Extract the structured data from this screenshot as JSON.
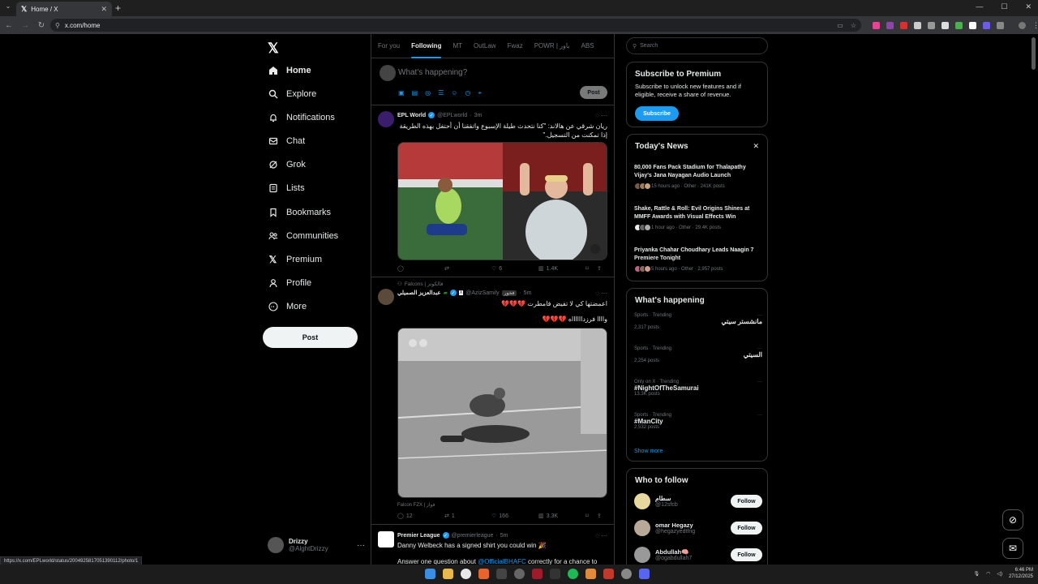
{
  "browser": {
    "tab_title": "Home / X",
    "url": "x.com/home",
    "status_url": "https://x.com/EPLworld/status/2004925817051390112/photo/1"
  },
  "sidebar": {
    "logo": "𝕏",
    "items": [
      {
        "label": "Home",
        "icon": "home-icon"
      },
      {
        "label": "Explore",
        "icon": "search-icon"
      },
      {
        "label": "Notifications",
        "icon": "bell-icon"
      },
      {
        "label": "Chat",
        "icon": "mail-icon"
      },
      {
        "label": "Grok",
        "icon": "grok-icon"
      },
      {
        "label": "Lists",
        "icon": "list-icon"
      },
      {
        "label": "Bookmarks",
        "icon": "bookmark-icon"
      },
      {
        "label": "Communities",
        "icon": "people-icon"
      },
      {
        "label": "Premium",
        "icon": "x-icon"
      },
      {
        "label": "Profile",
        "icon": "person-icon"
      },
      {
        "label": "More",
        "icon": "more-icon"
      }
    ],
    "post_label": "Post",
    "account": {
      "name": "Drizzy",
      "handle": "@AlghtDrizzy"
    }
  },
  "feed": {
    "tabs": [
      "For you",
      "Following",
      "MT",
      "OutLaw",
      "Fwaz",
      "POWR | باور",
      "ABS"
    ],
    "compose_placeholder": "What's happening?",
    "compose_post": "Post",
    "tweets": [
      {
        "name": "EPL World",
        "handle": "@EPLworld",
        "time": "3m",
        "text": "ريان شرقي عن هالاند: \"كنا نتحدث طيلة الإسبوع واتفقنا أن أحتفل بهذه الطريقة إذا تمكنت من التسجيل.\"",
        "replies": "",
        "reposts": "",
        "likes": "6",
        "views": "1.4K"
      },
      {
        "context": "Falcons | فالكونز",
        "name": "عبدالعزيز الصميلي",
        "handle": "@AzizSamily",
        "badge": "فخور",
        "time": "5m",
        "text": "اعمضتها كي لا تفيض فامطرت 💔💔💔",
        "text2": "واااا فرزدااااااه 💔💔💔",
        "media_caption": "Falcon FZX | فواز",
        "replies": "12",
        "reposts": "1",
        "likes": "166",
        "views": "3.3K"
      },
      {
        "name": "Premier League",
        "handle": "@premierleague",
        "time": "5m",
        "text": "Danny Welbeck has a signed shirt you could win 🎉",
        "text2_pre": "Answer one question about ",
        "text2_link": "@OfficialBHAFC",
        "text2_post": " correctly for a chance to make"
      }
    ]
  },
  "right": {
    "search_placeholder": "Search",
    "premium": {
      "title": "Subscribe to Premium",
      "desc": "Subscribe to unlock new features and if eligible, receive a share of revenue.",
      "button": "Subscribe"
    },
    "news": {
      "title": "Today's News",
      "items": [
        {
          "headline": "80,000 Fans Pack Stadium for Thalapathy Vijay's Jana Nayagan Audio Launch",
          "meta": "15 hours ago · Other · 241K posts"
        },
        {
          "headline": "Shake, Rattle & Roll: Evil Origins Shines at MMFF Awards with Visual Effects Win",
          "meta": "1 hour ago · Other · 29.4K posts"
        },
        {
          "headline": "Priyanka Chahar Choudhary Leads Naagin 7 Premiere Tonight",
          "meta": "5 hours ago · Other · 2,957 posts"
        }
      ]
    },
    "happening": {
      "title": "What's happening",
      "items": [
        {
          "context": "Sports · Trending",
          "topic": "مانشستر سيتي",
          "posts": "2,317 posts",
          "rtl": true
        },
        {
          "context": "Sports · Trending",
          "topic": "السيتي",
          "posts": "2,254 posts",
          "rtl": true
        },
        {
          "context": "Only on X · Trending",
          "topic": "#NightOfTheSamurai",
          "posts": "13.3K posts",
          "rtl": false
        },
        {
          "context": "Sports · Trending",
          "topic": "#ManCity",
          "posts": "2,532 posts",
          "rtl": false
        }
      ],
      "show_more": "Show more"
    },
    "who_to_follow": {
      "title": "Who to follow",
      "button": "Follow",
      "people": [
        {
          "name": "سطام",
          "handle": "@12sfcb"
        },
        {
          "name": "omar Hegazy",
          "handle": "@hegazyedtfng"
        },
        {
          "name": "Abdullah🧠",
          "handle": "@ogabdullah7"
        }
      ]
    }
  },
  "taskbar": {
    "time": "6:46 PM",
    "date": "27/12/2025"
  },
  "colors": {
    "accent": "#1d9bf0",
    "bg": "#000000",
    "border": "#2f3336",
    "muted": "#71767b"
  }
}
